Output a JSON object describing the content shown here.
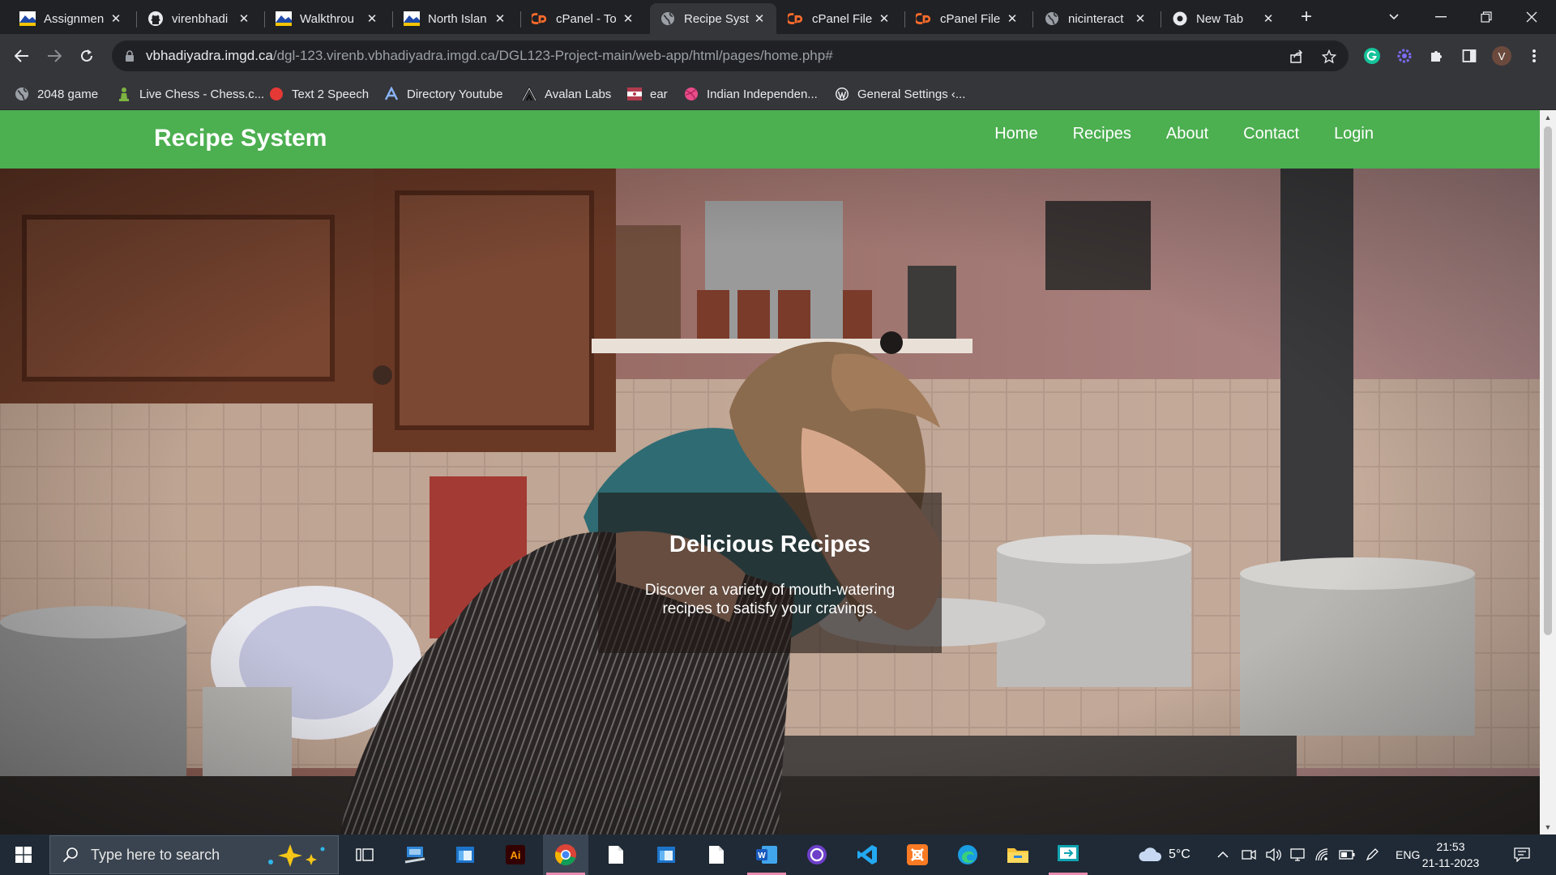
{
  "browser": {
    "tabs": [
      {
        "title": "Assignmen",
        "icon": "imgd-icon",
        "active": false
      },
      {
        "title": "virenbhadi",
        "icon": "github-icon",
        "active": false
      },
      {
        "title": "Walkthrou",
        "icon": "imgd-icon",
        "active": false
      },
      {
        "title": "North Islan",
        "icon": "imgd-icon",
        "active": false
      },
      {
        "title": "cPanel - To",
        "icon": "cpanel-icon",
        "active": false
      },
      {
        "title": "Recipe Syst",
        "icon": "globe-icon",
        "active": true
      },
      {
        "title": "cPanel File",
        "icon": "cpanel-icon",
        "active": false
      },
      {
        "title": "cPanel File",
        "icon": "cpanel-icon",
        "active": false
      },
      {
        "title": "nicinteract",
        "icon": "globe-icon",
        "active": false
      },
      {
        "title": "New Tab",
        "icon": "chrome-icon",
        "active": false
      }
    ],
    "close_glyph": "✕",
    "new_tab_glyph": "+",
    "address": {
      "host": "vbhadiyadra.imgd.ca",
      "path": "/dgl-123.virenb.vbhadiyadra.imgd.ca/DGL123-Project-main/web-app/html/pages/home.php#"
    },
    "profile_initial": "V",
    "bookmarks": [
      {
        "label": "2048 game",
        "icon": "globe-icon"
      },
      {
        "label": "Live Chess - Chess.c...",
        "icon": "chess-pawn-icon"
      },
      {
        "label": "Text 2 Speech",
        "icon": "red-circle-icon"
      },
      {
        "label": "Directory Youtube",
        "icon": "directory-logo-icon"
      },
      {
        "label": "Avalan Labs",
        "icon": "avalan-logo-icon"
      },
      {
        "label": "ear",
        "icon": "flag-icon"
      },
      {
        "label": "Indian Independen...",
        "icon": "pink-ball-icon"
      },
      {
        "label": "General Settings ‹...",
        "icon": "wordpress-icon"
      }
    ]
  },
  "site": {
    "brand": "Recipe System",
    "nav": [
      "Home",
      "Recipes",
      "About",
      "Contact",
      "Login"
    ],
    "hero": {
      "title": "Delicious Recipes",
      "text": "Discover a variety of mouth-watering recipes to satisfy your cravings."
    },
    "colors": {
      "header": "#4caf50",
      "overlay": "rgba(30,22,20,0.62)"
    }
  },
  "taskbar": {
    "search_placeholder": "Type here to search",
    "apps": [
      "task-view-icon",
      "network-app-icon",
      "window-app-icon",
      "illustrator-icon",
      "chrome-icon",
      "file-icon",
      "window-app-icon",
      "file-icon",
      "word-icon",
      "github-desktop-icon",
      "vscode-icon",
      "xampp-icon",
      "edge-icon",
      "file-explorer-icon",
      "remote-desktop-icon"
    ],
    "illustrator_label": "Ai",
    "word_label": "W",
    "weather": "5°C",
    "language": "ENG",
    "time": "21:53",
    "date": "21-11-2023"
  }
}
